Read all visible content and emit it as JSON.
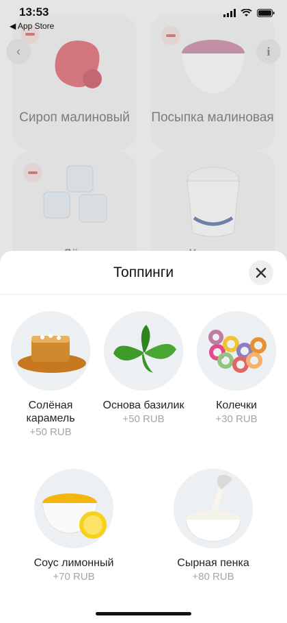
{
  "status_bar": {
    "time": "13:53",
    "back_label": "◀ App Store"
  },
  "background": {
    "cards": [
      {
        "name": "Сироп малиновый"
      },
      {
        "name": "Посыпка малиновая"
      },
      {
        "name": "Лёд"
      },
      {
        "name": "Крышка"
      }
    ]
  },
  "sheet": {
    "title": "Топпинги",
    "items": [
      {
        "name": "Солёная карамель",
        "price": "+50 RUB",
        "icon": "caramel-icon"
      },
      {
        "name": "Основа базилик",
        "price": "+50 RUB",
        "icon": "basil-icon"
      },
      {
        "name": "Колечки",
        "price": "+30 RUB",
        "icon": "cereal-rings-icon"
      },
      {
        "name": "Соус лимонный",
        "price": "+70 RUB",
        "icon": "lemon-sauce-icon"
      },
      {
        "name": "Сырная пенка",
        "price": "+80 RUB",
        "icon": "cheese-foam-icon"
      }
    ]
  },
  "colors": {
    "accent_remove": "#c9302c",
    "price_gray": "#a5a5a5"
  }
}
